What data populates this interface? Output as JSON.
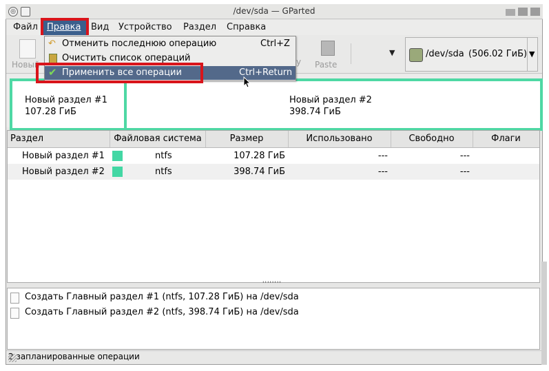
{
  "window": {
    "title": "/dev/sda — GParted"
  },
  "menubar": {
    "items": [
      {
        "label": "Файл"
      },
      {
        "label": "Правка"
      },
      {
        "label": "Вид"
      },
      {
        "label": "Устройство"
      },
      {
        "label": "Раздел"
      },
      {
        "label": "Справка"
      }
    ]
  },
  "toolbar": {
    "new_label": "Новый",
    "paste_label": "Paste",
    "partial_label": "y"
  },
  "edit_menu": {
    "items": [
      {
        "label": "Отменить последнюю операцию",
        "accel": "Ctrl+Z",
        "icon": "undo-icon"
      },
      {
        "label": "Очистить список операций",
        "accel": "",
        "icon": "clear-icon"
      },
      {
        "label": "Применить все операции",
        "accel": "Ctrl+Return",
        "icon": "checkmark-icon"
      }
    ]
  },
  "device": {
    "name": "/dev/sda",
    "size": "(506.02 ГиБ)"
  },
  "graph": {
    "partitions": [
      {
        "name": "Новый раздел #1",
        "size": "107.28 ГиБ"
      },
      {
        "name": "Новый раздел #2",
        "size": "398.74 ГиБ"
      }
    ]
  },
  "table": {
    "headers": [
      "Раздел",
      "Файловая система",
      "Размер",
      "Использовано",
      "Свободно",
      "Флаги"
    ],
    "rows": [
      {
        "partition": "Новый раздел #1",
        "fs": "ntfs",
        "size": "107.28 ГиБ",
        "used": "---",
        "free": "---",
        "flags": ""
      },
      {
        "partition": "Новый раздел #2",
        "fs": "ntfs",
        "size": "398.74 ГиБ",
        "used": "---",
        "free": "---",
        "flags": ""
      }
    ]
  },
  "operations": [
    {
      "text": "Создать Главный раздел #1 (ntfs, 107.28 ГиБ) на /dev/sda"
    },
    {
      "text": "Создать Главный раздел #2 (ntfs, 398.74 ГиБ) на /dev/sda"
    }
  ],
  "status": {
    "text": "2 запланированные операции"
  },
  "colors": {
    "ntfs": "#43d7a4",
    "highlight": "#d9141b",
    "menu_selection": "#53698a"
  }
}
